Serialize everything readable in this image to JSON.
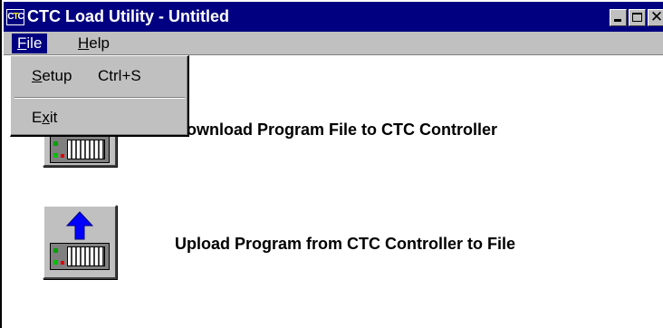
{
  "window": {
    "icon_text_a": "C",
    "icon_text_b": "T",
    "icon_text_c": "C",
    "title": "CTC Load Utility - Untitled",
    "controls": {
      "minimize_icon": "minimize-icon",
      "maximize_icon": "maximize-icon",
      "close_icon": "close-icon",
      "close_glyph": "✕"
    }
  },
  "menubar": {
    "file": {
      "accel": "F",
      "rest": "ile"
    },
    "help": {
      "accel": "H",
      "rest": "elp"
    }
  },
  "file_menu": {
    "setup": {
      "accel": "S",
      "rest": "etup",
      "shortcut": "Ctrl+S"
    },
    "exit": {
      "pre": "E",
      "accel": "x",
      "rest": "it"
    }
  },
  "actions": {
    "download": {
      "label_visible": "ownload Program File to CTC Controller",
      "icon": "controller-download-icon"
    },
    "upload": {
      "label": "Upload Program from CTC Controller to File",
      "icon": "controller-upload-icon",
      "arrow_color": "#0000ff"
    }
  },
  "colors": {
    "title_bar": "#000080",
    "menu_bg": "#c0c0c0",
    "content_bg": "#ffffff",
    "selected_menu": "#000080"
  }
}
